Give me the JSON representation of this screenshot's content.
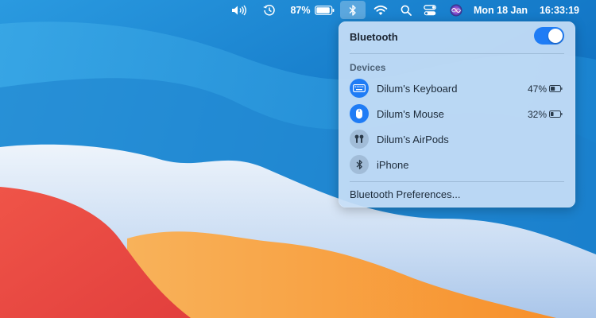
{
  "menubar": {
    "battery_percent": "87%",
    "date": "Mon 18 Jan",
    "time": "16:33:19"
  },
  "bluetooth_panel": {
    "title": "Bluetooth",
    "enabled": true,
    "section_label": "Devices",
    "devices": [
      {
        "name": "Dilum's Keyboard",
        "icon": "keyboard-icon",
        "connected": true,
        "battery_text": "47%",
        "battery_level": 0.47
      },
      {
        "name": "Dilum's Mouse",
        "icon": "mouse-icon",
        "connected": true,
        "battery_text": "32%",
        "battery_level": 0.32
      },
      {
        "name": "Dilum’s AirPods",
        "icon": "airpods-icon",
        "connected": false
      },
      {
        "name": "iPhone",
        "icon": "bluetooth-icon",
        "connected": false
      }
    ],
    "preferences_label": "Bluetooth Preferences..."
  },
  "colors": {
    "accent": "#1f7cf5",
    "panel_bg": "#c6def6",
    "wallpaper_sky": "#1479c8",
    "wallpaper_red": "#e84a45",
    "wallpaper_orange": "#f89a35"
  }
}
